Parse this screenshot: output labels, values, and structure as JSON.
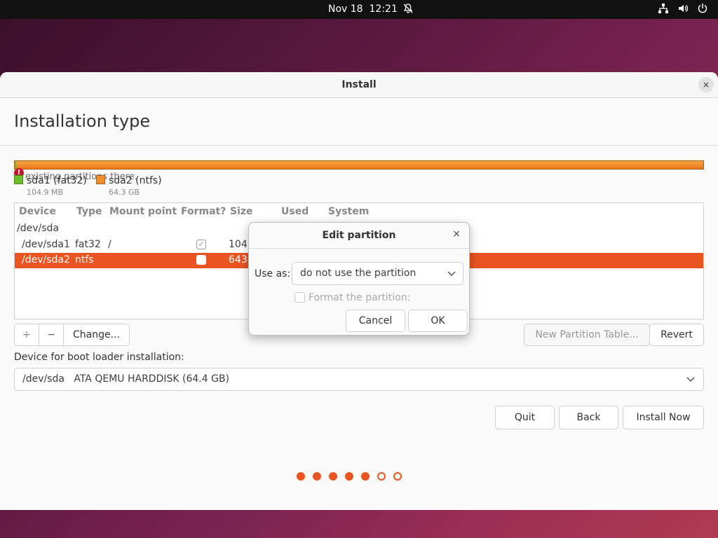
{
  "topbar": {
    "date": "Nov 18",
    "time": "12:21"
  },
  "window": {
    "title": "Install",
    "close_icon": "×"
  },
  "page": {
    "heading": "Installation type"
  },
  "partition_bar": {
    "colors": {
      "sda1": "#6bbf2c",
      "sda2": "#f0902c"
    }
  },
  "warning": {
    "text": "existing partitions there."
  },
  "legend": [
    {
      "name": "sda1 (fat32)",
      "size": "104.9 MB",
      "color": "#6bbf2c"
    },
    {
      "name": "sda2 (ntfs)",
      "size": "64.3 GB",
      "color": "#f0902c"
    }
  ],
  "table": {
    "headers": [
      "Device",
      "Type",
      "Mount point",
      "Format?",
      "Size",
      "Used",
      "System"
    ],
    "rows": [
      {
        "device": "/dev/sda"
      },
      {
        "device": "/dev/sda1",
        "type": "fat32",
        "mount": "/",
        "format": true,
        "size": "104"
      },
      {
        "device": "/dev/sda2",
        "type": "ntfs",
        "mount": "",
        "format": false,
        "size": "6431",
        "selected": true
      }
    ]
  },
  "table_buttons": {
    "add": "+",
    "remove": "−",
    "change": "Change...",
    "new_table": "New Partition Table...",
    "revert": "Revert"
  },
  "bootloader": {
    "label": "Device for boot loader installation:",
    "device": "/dev/sda",
    "description": "ATA QEMU HARDDISK (64.4 GB)"
  },
  "nav_buttons": {
    "quit": "Quit",
    "back": "Back",
    "install": "Install Now"
  },
  "progress": {
    "total": 7,
    "completed": 5
  },
  "dialog": {
    "title": "Edit partition",
    "close_icon": "×",
    "use_as_label": "Use as:",
    "use_as_value": "do not use the partition",
    "format_label": "Format the partition:",
    "cancel": "Cancel",
    "ok": "OK"
  },
  "accent_color": "#e95420"
}
